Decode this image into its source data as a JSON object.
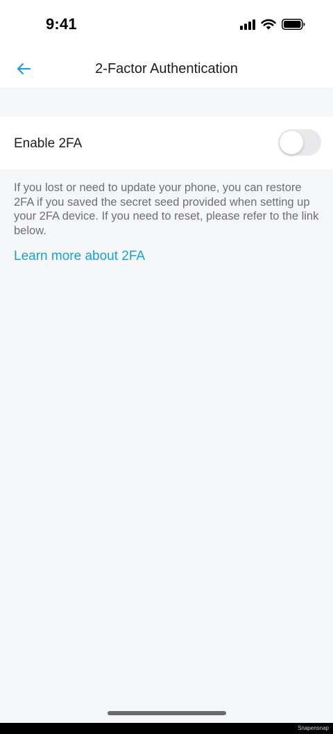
{
  "status_bar": {
    "time": "9:41",
    "icons": [
      "signal-icon",
      "wifi-icon",
      "battery-icon"
    ]
  },
  "header": {
    "back_icon": "arrow-left-icon",
    "title": "2-Factor Authentication"
  },
  "settings": {
    "enable_2fa_label": "Enable 2FA",
    "enable_2fa_on": false
  },
  "description": "If you lost or need to update your phone, you can restore 2FA if you saved the secret seed provided when setting up your 2FA device. If you need to reset, please refer to the link below.",
  "learn_more_link": "Learn more about 2FA",
  "watermark": "Snapensnap",
  "colors": {
    "accent": "#1a9fd9",
    "background": "#f5f6f8",
    "surface": "#ffffff",
    "secondary_text": "#6e6e73",
    "toggle_off": "#e9e9eb"
  }
}
